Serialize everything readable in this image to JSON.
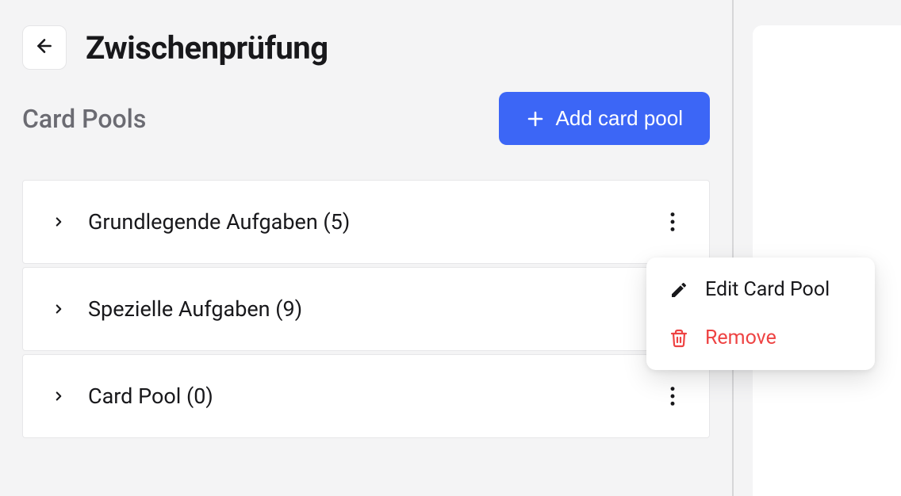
{
  "header": {
    "title": "Zwischenprüfung",
    "section": "Card Pools",
    "add_button": "Add card pool"
  },
  "pools": [
    {
      "label": "Grundlegende Aufgaben (5)"
    },
    {
      "label": "Spezielle Aufgaben (9)"
    },
    {
      "label": "Card Pool (0)"
    }
  ],
  "context_menu": {
    "edit": "Edit Card Pool",
    "remove": "Remove"
  }
}
